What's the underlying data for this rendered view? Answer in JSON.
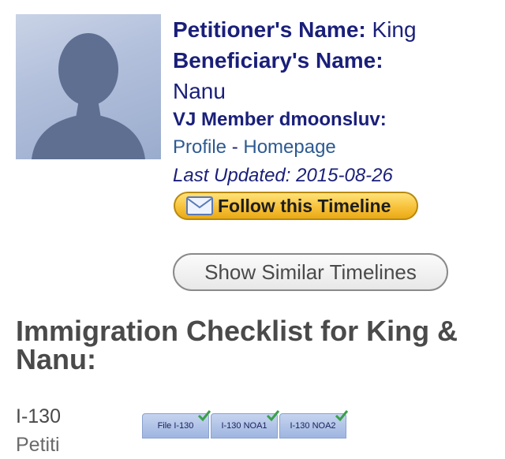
{
  "profile": {
    "petitioner_label": "Petitioner's Name:",
    "petitioner_name": "King",
    "beneficiary_label": "Beneficiary's Name:",
    "beneficiary_name": "Nanu",
    "member_line": "VJ Member dmoonsluv:",
    "profile_link": "Profile",
    "link_separator": " - ",
    "homepage_link": "Homepage",
    "last_updated": "Last Updated: 2015-08-26"
  },
  "buttons": {
    "follow": "Follow this Timeline",
    "similar": "Show Similar Timelines"
  },
  "checklist": {
    "title": "Immigration Checklist for King & Nanu:",
    "row_label": "I-130",
    "row_label_cont": "Petiti",
    "steps": [
      "File I-130",
      "I-130 NOA1",
      "I-130 NOA2"
    ]
  },
  "icons": {
    "avatar": "person-silhouette-icon",
    "follow": "envelope-icon",
    "step_check": "checkmark-icon"
  },
  "colors": {
    "label_text": "#1a1f7a",
    "link": "#2d5a92",
    "heading": "#4a4a4a",
    "follow_button": "#f7c23a",
    "step_tab": "#b3c6ea",
    "check": "#3aa04a"
  }
}
